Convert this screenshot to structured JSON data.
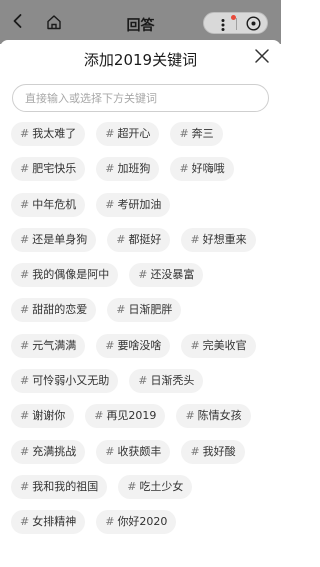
{
  "header": {
    "title": "回答"
  },
  "sheet": {
    "title": "添加2019关键词"
  },
  "search": {
    "placeholder": "直接输入或选择下方关键词",
    "value": ""
  },
  "tag_prefix": "#",
  "tag_rows": [
    [
      "我太难了",
      "超开心",
      "奔三"
    ],
    [
      "肥宅快乐",
      "加班狗",
      "好嗨哦"
    ],
    [
      "中年危机",
      "考研加油"
    ],
    [
      "还是单身狗",
      "都挺好",
      "好想重来"
    ],
    [
      "我的偶像是阿中",
      "还没暴富"
    ],
    [
      "甜甜的恋爱",
      "日渐肥胖"
    ],
    [
      "元气满满",
      "要啥没啥",
      "完美收官"
    ],
    [
      "可怜弱小又无助",
      "日渐秃头"
    ],
    [
      "谢谢你",
      "再见2019",
      "陈情女孩"
    ],
    [
      "充满挑战",
      "收获颇丰",
      "我好酸"
    ],
    [
      "我和我的祖国",
      "吃土少女"
    ],
    [
      "女排精神",
      "你好2020"
    ]
  ],
  "colors": {
    "topbar": "#8b8b8b",
    "tag_bg": "#f2f2f2",
    "notification_dot": "#e8493a"
  },
  "icons": [
    "back-arrow-icon",
    "home-icon",
    "more-icon",
    "close-circle-icon",
    "close-icon"
  ]
}
